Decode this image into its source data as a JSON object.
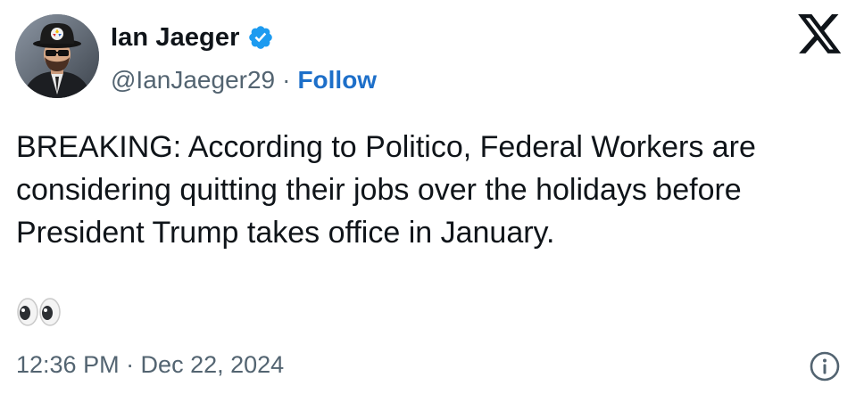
{
  "author": {
    "display_name": "Ian Jaeger",
    "handle": "@IanJaeger29",
    "separator": "·",
    "follow_label": "Follow",
    "verified_icon": "verified-badge-icon",
    "avatar_icon": "avatar-image"
  },
  "platform": {
    "logo_icon": "x-logo-icon"
  },
  "tweet": {
    "text": "BREAKING: According to Politico, Federal Workers are considering quitting their jobs over the holidays before President Trump takes office in January.",
    "emoji": "👀",
    "timestamp": "12:36 PM · Dec 22, 2024",
    "info_icon": "info-icon"
  },
  "colors": {
    "link_blue": "#1d6fc9",
    "verified_blue": "#1d9bf0",
    "text_primary": "#0f1419",
    "text_secondary": "#536471"
  }
}
